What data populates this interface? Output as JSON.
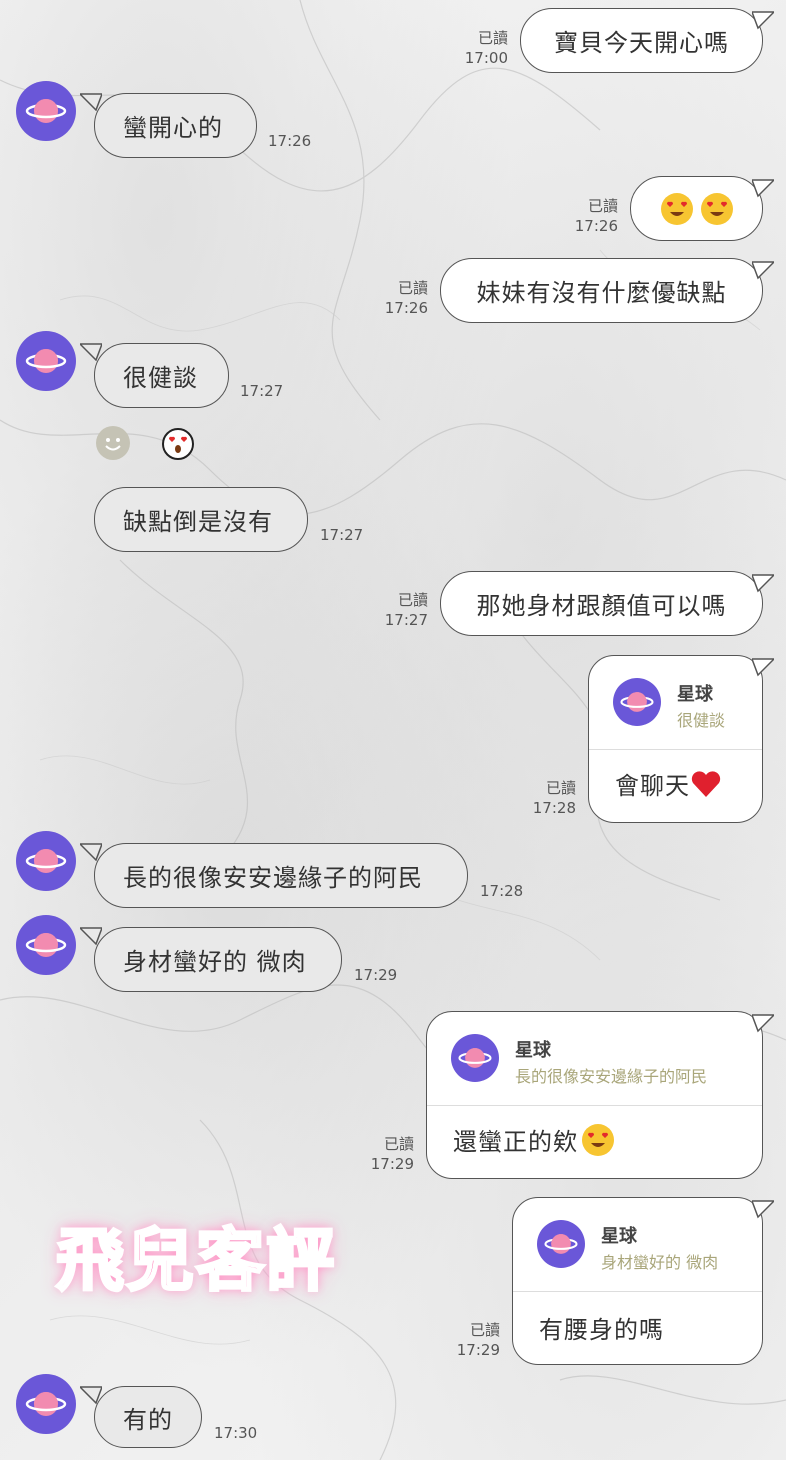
{
  "read_label": "已讀",
  "messages": {
    "m1": {
      "text": "寶貝今天開心嗎",
      "time": "17:00"
    },
    "m2": {
      "text": "蠻開心的",
      "time": "17:26"
    },
    "m3": {
      "emoji": "heart-eyes-emoji x2",
      "time": "17:26"
    },
    "m4": {
      "text": "妹妹有沒有什麼優缺點",
      "time": "17:26"
    },
    "m5": {
      "text": "很健談",
      "time": "17:27"
    },
    "m6": {
      "text": "缺點倒是沒有",
      "time": "17:27"
    },
    "m7": {
      "text": "那她身材跟顏值可以嗎",
      "time": "17:27"
    },
    "m8": {
      "reply_name": "星球",
      "reply_quote": "很健談",
      "text": "會聊天",
      "time": "17:28"
    },
    "m9": {
      "text": "長的很像安安邊緣子的阿民",
      "time": "17:28"
    },
    "m10": {
      "text": "身材蠻好的 微肉",
      "time": "17:29"
    },
    "m11": {
      "reply_name": "星球",
      "reply_quote": "長的很像安安邊緣子的阿民",
      "text": "還蠻正的欸",
      "time": "17:29"
    },
    "m12": {
      "reply_name": "星球",
      "reply_quote": "身材蠻好的 微肉",
      "text": "有腰身的嗎",
      "time": "17:29"
    },
    "m13": {
      "text": "有的",
      "time": "17:30"
    }
  },
  "watermark": "飛兒客評",
  "colors": {
    "avatar": "#6a57d8",
    "planet": "#f28bb0",
    "quote": "#a9a67a",
    "incoming_bubble": "#e9e9e9",
    "outgoing_bubble": "#ffffff"
  }
}
